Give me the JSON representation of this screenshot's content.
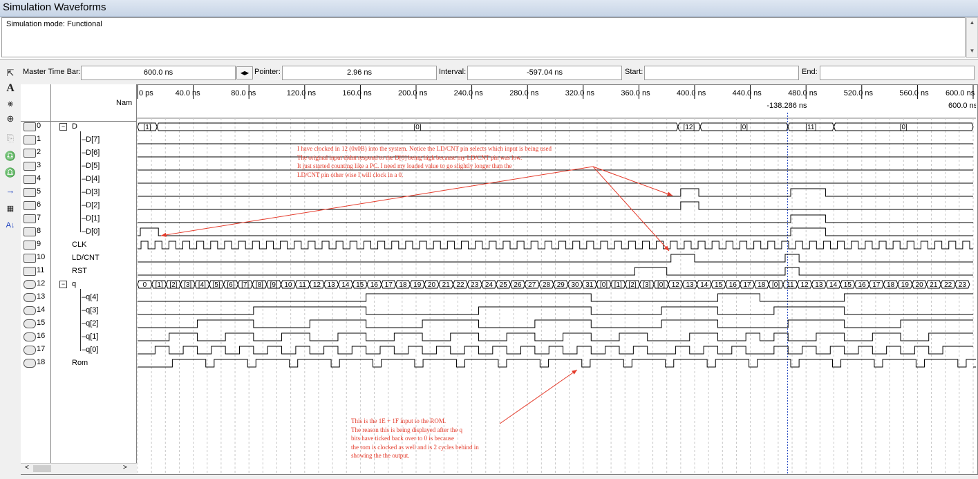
{
  "window": {
    "title": "Simulation Waveforms"
  },
  "mode": {
    "text": "Simulation mode: Functional"
  },
  "toolbar": {
    "master_time_bar_label": "Master Time Bar:",
    "master_time_bar_value": "600.0 ns",
    "pointer_label": "Pointer:",
    "pointer_value": "2.96 ns",
    "interval_label": "Interval:",
    "interval_value": "-597.04 ns",
    "start_label": "Start:",
    "start_value": "",
    "end_label": "End:",
    "end_value": ""
  },
  "tools": [
    "selection-tool-icon",
    "text-tool-icon",
    "waveform-editing-tool-icon",
    "zoom-tool-icon",
    "copy-icon",
    "find-icon",
    "replace-icon",
    "next-transition-icon",
    "group-icon",
    "sort-icon"
  ],
  "header": {
    "name_column": "Nam"
  },
  "time_axis": {
    "ticks": [
      "0 ps",
      "40.0 ns",
      "80.0 ns",
      "120.0 ns",
      "160.0 ns",
      "200.0 ns",
      "240.0 ns",
      "280.0 ns",
      "320.0 ns",
      "360.0 ns",
      "400.0 ns",
      "440.0 ns",
      "480.0 ns",
      "520.0 ns",
      "560.0 ns",
      "600.0 ns"
    ],
    "cursor_label": "-138.286 ns",
    "end_marker_label": "600.0 ns",
    "range_ns": [
      0,
      600
    ]
  },
  "rows": [
    {
      "index": "0",
      "name": "D",
      "group": true
    },
    {
      "index": "1",
      "name": "D[7]"
    },
    {
      "index": "2",
      "name": "D[6]"
    },
    {
      "index": "3",
      "name": "D[5]"
    },
    {
      "index": "4",
      "name": "D[4]"
    },
    {
      "index": "5",
      "name": "D[3]"
    },
    {
      "index": "6",
      "name": "D[2]"
    },
    {
      "index": "7",
      "name": "D[1]"
    },
    {
      "index": "8",
      "name": "D[0]"
    },
    {
      "index": "9",
      "name": "CLK"
    },
    {
      "index": "10",
      "name": "LD/CNT"
    },
    {
      "index": "11",
      "name": "RST"
    },
    {
      "index": "12",
      "name": "q",
      "group": true
    },
    {
      "index": "13",
      "name": "q[4]"
    },
    {
      "index": "14",
      "name": "q[3]"
    },
    {
      "index": "15",
      "name": "q[2]"
    },
    {
      "index": "16",
      "name": "q[1]"
    },
    {
      "index": "17",
      "name": "q[0]"
    },
    {
      "index": "18",
      "name": "Rom"
    }
  ],
  "bus_values": {
    "D": [
      "[1]",
      "[0]",
      "[12]",
      "[0]",
      "[11]",
      "[0]"
    ],
    "q": [
      "0",
      "[1]",
      "[2]",
      "[3]",
      "[4]",
      "[5]",
      "[6]",
      "[7]",
      "[8]",
      "[9]",
      "10",
      "11",
      "12",
      "13",
      "14",
      "15",
      "16",
      "17",
      "18",
      "19",
      "20",
      "21",
      "22",
      "23",
      "24",
      "25",
      "26",
      "27",
      "28",
      "29",
      "30",
      "31",
      "[0]",
      "[1]",
      "[2]",
      "[3]",
      "[0]",
      "12",
      "13",
      "14",
      "15",
      "16",
      "17",
      "18",
      "[0]",
      "11",
      "12",
      "13",
      "14",
      "15",
      "16",
      "17",
      "18",
      "19",
      "20",
      "21",
      "22",
      "23"
    ]
  },
  "annotations": {
    "note1": [
      "I have clocked in 12 (0x0B) into the system. Notice the LD/CNT pin selects which input is being used",
      "The original input didnt respond to the D[0] being high because my LD/CNT pin was low.",
      "It just started counting like a PC. I need my loaded value to go slightly longer than the",
      "LD/CNT pin other wise I will clock in a 0."
    ],
    "note2": [
      "This is the 1E + 1F input to the ROM.",
      "The reason this is being displayed after the q",
      "bits have ticked back over to 0 is because",
      "the rom is clocked as well and is 2 cycles behind in",
      "showing the the output."
    ]
  },
  "colors": {
    "annotation": "#e43b2b",
    "wave": "#000000",
    "cursor": "#1a3fbf"
  }
}
